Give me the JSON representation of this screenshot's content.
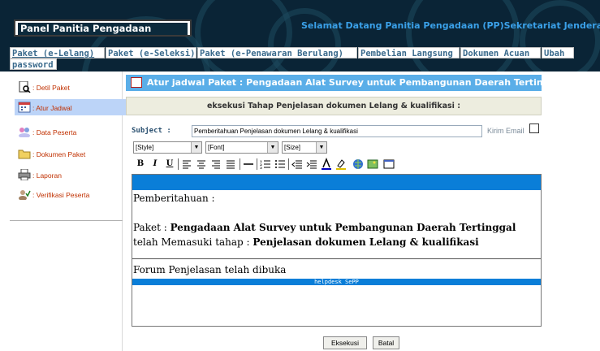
{
  "header": {
    "app_title": "Panel Panitia Pengadaan",
    "welcome": "Selamat Datang Panitia Pengadaan (PP)Sekretariat Jendera"
  },
  "tabs": [
    {
      "label": "Paket (e-Lelang)"
    },
    {
      "label": "Paket (e-Seleksi)"
    },
    {
      "label": "Paket (e-Penawaran Berulang)"
    },
    {
      "label": "Pembelian Langsung"
    },
    {
      "label": "Dokumen Acuan"
    },
    {
      "label": "Ubah"
    },
    {
      "label": "password"
    }
  ],
  "sidebar": {
    "items": [
      {
        "label": ": Detil Paket",
        "icon": "document-search-icon"
      },
      {
        "label": ": Atur Jadwal",
        "icon": "calendar-icon"
      },
      {
        "label": ": Data Peserta",
        "icon": "users-icon"
      },
      {
        "label": ": Dokumen Paket",
        "icon": "folder-icon"
      },
      {
        "label": ": Laporan",
        "icon": "printer-icon"
      },
      {
        "label": ": Verifikasi Peserta",
        "icon": "verify-user-icon"
      }
    ]
  },
  "main": {
    "banner": "Atur jadwal Paket : Pengadaan Alat Survey untuk Pembangunan Daerah Tertinggal",
    "subheader": "eksekusi Tahap Penjelasan dokumen Lelang & kualifikasi :",
    "subject_label": "Subject :",
    "subject_value": "Pemberitahuan Penjelasan dokumen Lelang & kualifikasi",
    "kirim_email_label": "Kirim Email",
    "style_select": "[Style]",
    "font_select": "[Font]",
    "size_select": "[Size]",
    "editor": {
      "line1": "Pemberitahuan :",
      "paket_prefix": "Paket : ",
      "paket_name": "Pengadaan Alat Survey untuk Pembangunan Daerah Tertinggal",
      "tahap_prefix": "telah Memasuki tahap : ",
      "tahap_name": "Penjelasan dokumen Lelang & kualifikasi",
      "forum": "Forum Penjelasan telah dibuka",
      "footer": "helpdesk SePP"
    },
    "execute_button": "Eksekusi",
    "cancel_button": "Batal"
  },
  "colors": {
    "header_bg": "#0a2436",
    "banner_bg": "#5aaee8",
    "editor_bar": "#0a7ed8",
    "tab_text": "#3a6a8c",
    "sidebar_text": "#c03000"
  }
}
